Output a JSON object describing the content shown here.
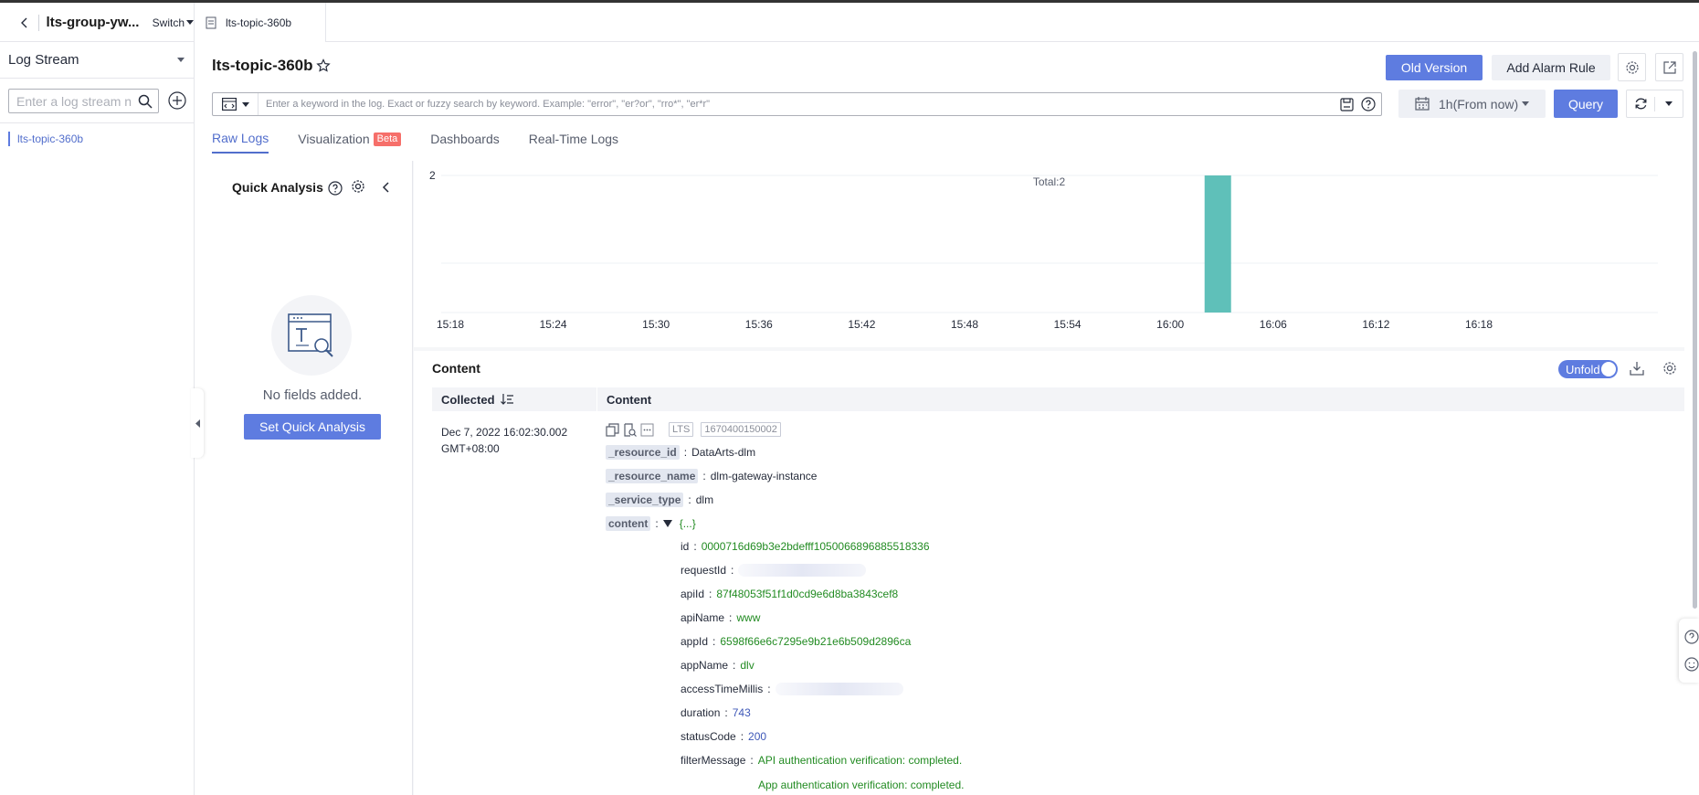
{
  "topbar": {
    "group_name": "lts-group-yw...",
    "switch_label": "Switch",
    "tab_label": "lts-topic-360b"
  },
  "sidebar": {
    "title": "Log Stream",
    "search_placeholder": "Enter a log stream n",
    "items": [
      {
        "label": "lts-topic-360b"
      }
    ]
  },
  "header": {
    "title": "lts-topic-360b",
    "old_version": "Old Version",
    "add_alarm": "Add Alarm Rule"
  },
  "query": {
    "placeholder": "Enter a keyword in the log. Exact or fuzzy search by keyword. Example: \"error\", \"er?or\", \"rro*\", \"er*r\"",
    "time_range": "1h(From now)",
    "query_button": "Query"
  },
  "tabs": [
    {
      "label": "Raw Logs",
      "active": true
    },
    {
      "label": "Visualization",
      "badge": "Beta"
    },
    {
      "label": "Dashboards"
    },
    {
      "label": "Real-Time Logs"
    }
  ],
  "quick_analysis": {
    "title": "Quick Analysis",
    "empty_text": "No fields added.",
    "button": "Set Quick Analysis"
  },
  "chart_data": {
    "type": "bar",
    "title": "Total:2",
    "x_ticks": [
      "15:18",
      "15:24",
      "15:30",
      "15:36",
      "15:42",
      "15:48",
      "15:54",
      "16:00",
      "16:06",
      "16:12",
      "16:18"
    ],
    "y_ticks": [
      "2"
    ],
    "ylim": [
      0,
      2
    ],
    "bars": [
      {
        "x": "16:02",
        "value": 2
      }
    ],
    "color": "#5fc0b9"
  },
  "logs": {
    "title": "Content",
    "unfold_label": "Unfold",
    "col_collected": "Collected",
    "col_content": "Content",
    "rows": [
      {
        "time_line1": "Dec 7, 2022 16:02:30.002",
        "time_line2": "GMT+08:00",
        "tag1": "LTS",
        "tag2": "1670400150002",
        "fields": [
          {
            "key": "_resource_id",
            "value": "DataArts-dlm"
          },
          {
            "key": "_resource_name",
            "value": "dlm-gateway-instance"
          },
          {
            "key": "_service_type",
            "value": "dlm"
          },
          {
            "key": "content",
            "value": "{...}"
          }
        ],
        "sub_fields": [
          {
            "key": "id",
            "value": "0000716d69b3e2bdefff1050066896885518336",
            "kind": "str"
          },
          {
            "key": "requestId",
            "value": "",
            "kind": "blur"
          },
          {
            "key": "apiId",
            "value": "87f48053f51f1d0cd9e6d8ba3843cef8",
            "kind": "str"
          },
          {
            "key": "apiName",
            "value": "www",
            "kind": "str"
          },
          {
            "key": "appId",
            "value": "6598f66e6c7295e9b21e6b509d2896ca",
            "kind": "str"
          },
          {
            "key": "appName",
            "value": "dlv",
            "kind": "str"
          },
          {
            "key": "accessTimeMillis",
            "value": "",
            "kind": "blur"
          },
          {
            "key": "duration",
            "value": "743",
            "kind": "num"
          },
          {
            "key": "statusCode",
            "value": "200",
            "kind": "num"
          },
          {
            "key": "filterMessage",
            "value": "API authentication verification: completed.",
            "kind": "str"
          }
        ],
        "filter_message_line2": "App authentication verification: completed."
      }
    ]
  },
  "colors": {
    "primary": "#5e7ce0",
    "beta_badge": "#f66f6a",
    "bar": "#5fc0b9"
  }
}
